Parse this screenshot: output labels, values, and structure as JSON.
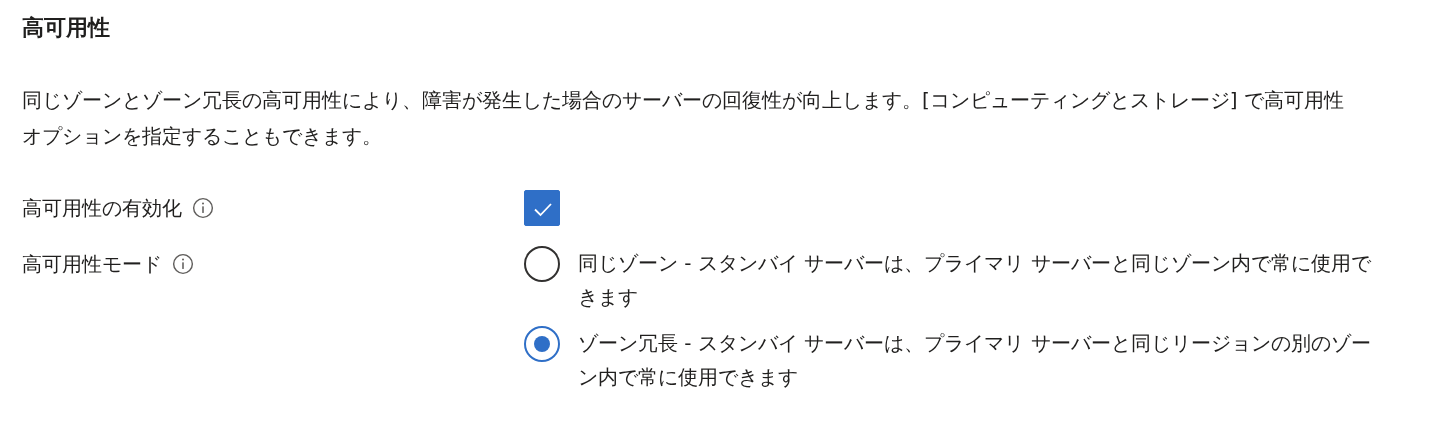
{
  "section": {
    "title": "高可用性",
    "description": "同じゾーンとゾーン冗長の高可用性により、障害が発生した場合のサーバーの回復性が向上します。[コンピューティングとストレージ] で高可用性オプションを指定することもできます。"
  },
  "fields": [
    {
      "kind": "checkbox",
      "label": "高可用性の有効化",
      "checked": true
    },
    {
      "kind": "radio",
      "label": "高可用性モード",
      "options": [
        {
          "label": "同じゾーン - スタンバイ サーバーは、プライマリ サーバーと同じゾーン内で常に使用できます",
          "selected": false
        },
        {
          "label": "ゾーン冗長 - スタンバイ サーバーは、プライマリ サーバーと同じリージョンの別のゾーン内で常に使用できます",
          "selected": true
        }
      ]
    }
  ]
}
